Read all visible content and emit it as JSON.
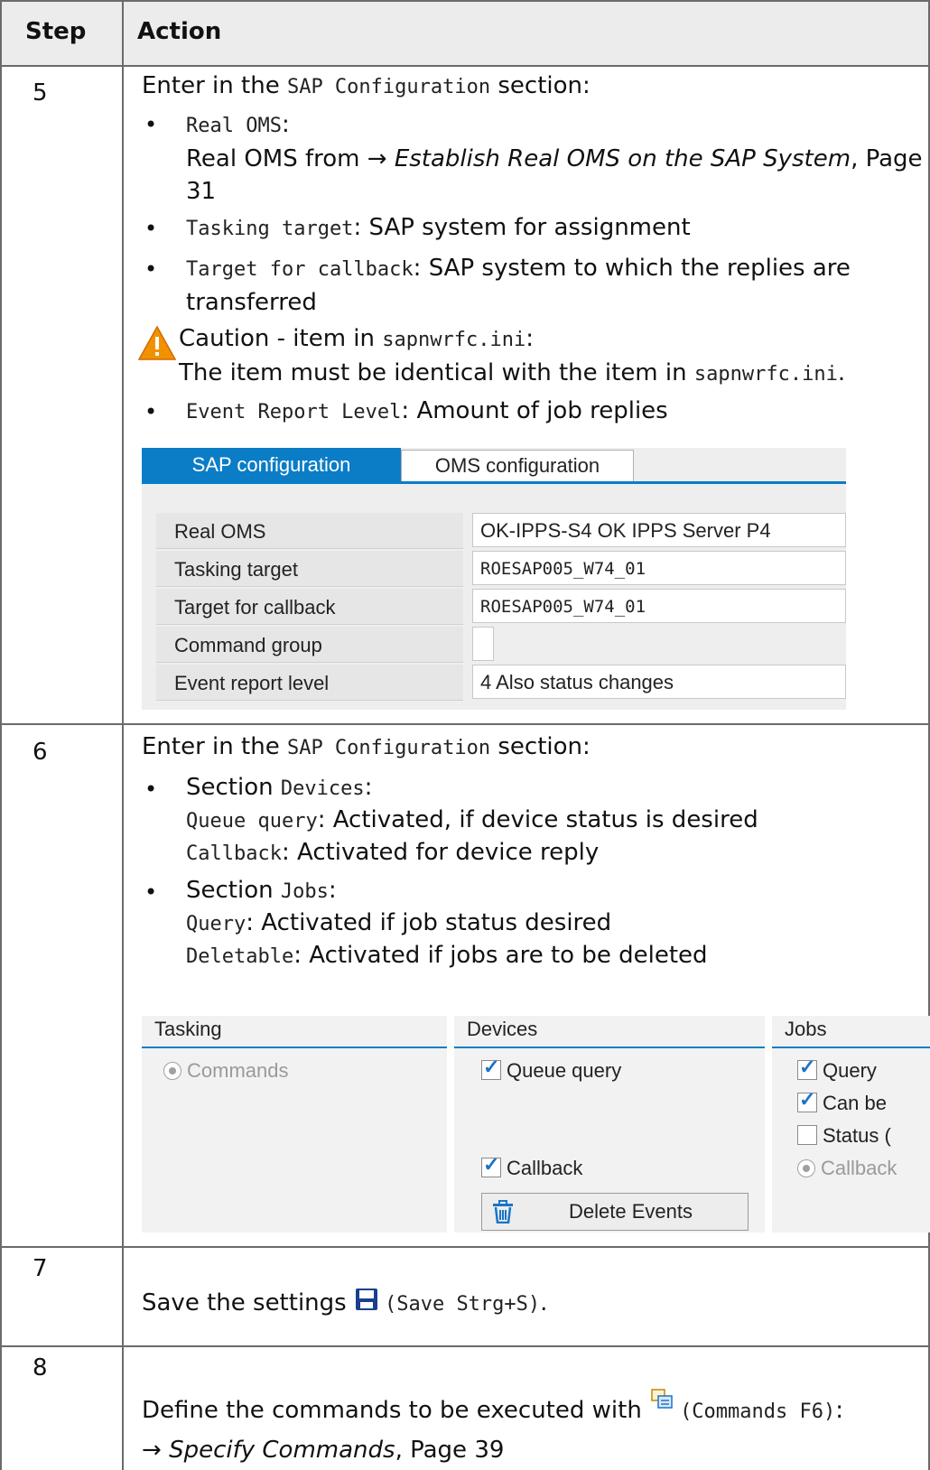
{
  "header": {
    "step": "Step",
    "action": "Action"
  },
  "steps": [
    {
      "num": "5",
      "intro_pre": "Enter in the ",
      "intro_code": "SAP Configuration",
      "intro_post": " section:",
      "bullets": [
        {
          "code": "Real OMS",
          "text": ":",
          "line2_pre": "Real OMS from → ",
          "line2_italic": "Establish Real OMS on the SAP System",
          "line2_post": ", Page",
          "line3": "31"
        },
        {
          "code": "Tasking target",
          "text": ": SAP system for assignment"
        },
        {
          "code": "Target for callback",
          "text": ": SAP system to which the replies are",
          "line2": "transferred"
        }
      ],
      "caution": {
        "pre": "Caution - item in ",
        "code": "sapnwrfc.ini",
        "post": ":",
        "line2_pre": "The item must be identical with the item in ",
        "line2_code": "sapnwrfc.ini",
        "line2_post": "."
      },
      "bullet_last": {
        "code": "Event Report Level",
        "text": ": Amount of job replies"
      },
      "screen": {
        "tab_active": "SAP configuration",
        "tab_inactive": "OMS configuration",
        "fields": [
          {
            "label": "Real OMS",
            "value": "OK-IPPS-S4 OK IPPS Server P4"
          },
          {
            "label": "Tasking target",
            "value": "ROESAP005_W74_01"
          },
          {
            "label": "Target for callback",
            "value": "ROESAP005_W74_01"
          },
          {
            "label": "Command group",
            "value": ""
          },
          {
            "label": "Event report level",
            "value": "4 Also status changes"
          }
        ]
      }
    },
    {
      "num": "6",
      "intro_pre": "Enter in the ",
      "intro_code": "SAP Configuration",
      "intro_post": " section:",
      "b1_pre": "Section ",
      "b1_code": "Devices",
      "b1_post": ":",
      "b1_l2_code": "Queue query",
      "b1_l2_text": ": Activated, if device status is desired",
      "b1_l3_code": "Callback",
      "b1_l3_text": ": Activated for device reply",
      "b2_pre": "Section ",
      "b2_code": "Jobs",
      "b2_post": ":",
      "b2_l2_code": "Query",
      "b2_l2_text": ": Activated if job status desired",
      "b2_l3_code": "Deletable",
      "b2_l3_text": ": Activated if jobs are to be deleted",
      "screen": {
        "tasking_title": "Tasking",
        "tasking_commands": "Commands",
        "devices_title": "Devices",
        "queue_query": "Queue query",
        "callback": "Callback",
        "delete_events": "Delete Events",
        "jobs_title": "Jobs",
        "jobs_query": "Query",
        "jobs_can_be": "Can be",
        "jobs_status": "Status (",
        "jobs_callback": "Callback"
      }
    },
    {
      "num": "7",
      "text_pre": "Save the settings ",
      "text_code": "(Save Strg+S)",
      "text_post": "."
    },
    {
      "num": "8",
      "text_pre": "Define the commands to be executed with ",
      "text_code": "(Commands F6)",
      "text_post": ":",
      "line2_pre": "→ ",
      "line2_italic": "Specify Commands",
      "line2_post": ", Page 39"
    }
  ],
  "colors": {
    "header_bg": "#ececec",
    "sap_blue": "#0b7dc7",
    "checkmark": "#1a74c7",
    "warning": "#f29100"
  },
  "icons": [
    "warning-icon",
    "save-icon",
    "commands-icon",
    "trash-icon"
  ]
}
